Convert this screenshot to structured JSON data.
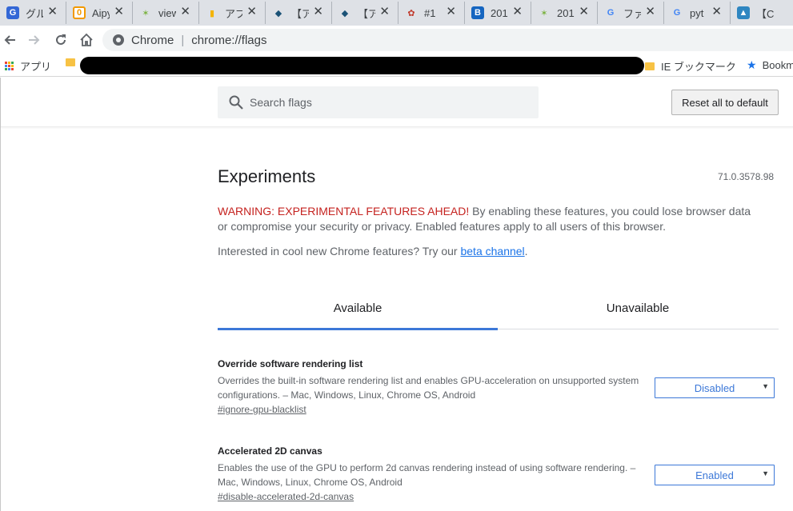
{
  "tabs": [
    {
      "favicon_text": "G",
      "favicon_color": "#3367d6",
      "title": "グループ"
    },
    {
      "favicon_text": "0",
      "favicon_color": "#f29900",
      "title": "Aipy"
    },
    {
      "favicon_text": "✶",
      "favicon_color": "#7cb342",
      "title": "view"
    },
    {
      "favicon_text": "▮",
      "favicon_color": "#f4b400",
      "title": "アプリ"
    },
    {
      "favicon_text": "◆",
      "favicon_color": "#1a5276",
      "title": "【ア"
    },
    {
      "favicon_text": "◆",
      "favicon_color": "#1a5276",
      "title": "【ア"
    },
    {
      "favicon_text": "✿",
      "favicon_color": "#c0392b",
      "title": "#1"
    },
    {
      "favicon_text": "B",
      "favicon_color": "#1565c0",
      "title": "201"
    },
    {
      "favicon_text": "✶",
      "favicon_color": "#7cb342",
      "title": "201"
    },
    {
      "favicon_text": "G",
      "favicon_color": "#4285f4",
      "title": "ファ"
    },
    {
      "favicon_text": "G",
      "favicon_color": "#4285f4",
      "title": "pyt"
    },
    {
      "favicon_text": "▲",
      "favicon_color": "#2e86c1",
      "title": "【Ch"
    }
  ],
  "toolbar": {
    "back_icon": "back-arrow-icon",
    "forward_icon": "forward-arrow-icon",
    "reload_icon": "reload-icon",
    "home_icon": "home-icon",
    "omnibox_label": "Chrome",
    "omnibox_separator": "|",
    "omnibox_url": "chrome://flags"
  },
  "bookmarks": {
    "apps_label": "アプリ",
    "ie_label": "IE ブックマーク",
    "bookmarks_label": "Bookm"
  },
  "search": {
    "placeholder": "Search flags"
  },
  "reset_label": "Reset all to default",
  "title": "Experiments",
  "version": "71.0.3578.98",
  "warning_red": "WARNING: EXPERIMENTAL FEATURES AHEAD!",
  "warning_rest": " By enabling these features, you could lose browser data or compromise your security or privacy. Enabled features apply to all users of this browser.",
  "interest_text": "Interested in cool new Chrome features? Try our ",
  "interest_link": "beta channel",
  "interest_end": ".",
  "page_tabs": [
    "Available",
    "Unavailable"
  ],
  "experiments": [
    {
      "name": "Override software rendering list",
      "description": "Overrides the built-in software rendering list and enables GPU-acceleration on unsupported system configurations. – Mac, Windows, Linux, Chrome OS, Android",
      "link": "#ignore-gpu-blacklist",
      "value": "Disabled"
    },
    {
      "name": "Accelerated 2D canvas",
      "description": "Enables the use of the GPU to perform 2d canvas rendering instead of using software rendering. – Mac, Windows, Linux, Chrome OS, Android",
      "link": "#disable-accelerated-2d-canvas",
      "value": "Enabled"
    }
  ],
  "colors": {
    "warning_red": "#c5221f",
    "accent_blue": "#3c78d8"
  }
}
